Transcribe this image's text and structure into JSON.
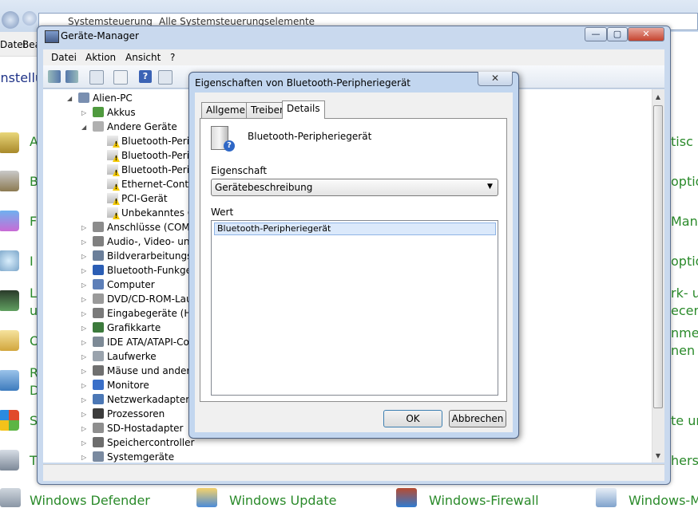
{
  "control_panel": {
    "breadcrumb": [
      "Systemsteuerung",
      "Alle Systemsteuerungselemente"
    ],
    "menu": [
      "Datei",
      "Bea"
    ],
    "heading_fragment": "instellu",
    "left_fragments": [
      "A",
      "B",
      "F",
      "I",
      "L",
      "u",
      "O",
      "R",
      "D",
      "S",
      "T"
    ],
    "right_fragments": [
      "tisc",
      "optio",
      "Mana",
      "optio",
      "rk- u",
      "ecent",
      "nme",
      "nen",
      "te un",
      "herst"
    ],
    "bottom_items": [
      "Windows Defender",
      "Windows Update",
      "Windows-Firewall",
      "Windows-M"
    ]
  },
  "device_manager": {
    "title": "Geräte-Manager",
    "caption_buttons": {
      "minimize": "—",
      "maximize": "▢",
      "close": "✕"
    },
    "menu": [
      "Datei",
      "Aktion",
      "Ansicht",
      "?"
    ],
    "tree": [
      {
        "label": "Alien-PC",
        "level": 0,
        "expanded": true,
        "icon": "computer-icon"
      },
      {
        "label": "Akkus",
        "level": 1,
        "expanded": false,
        "icon": "battery-icon"
      },
      {
        "label": "Andere Geräte",
        "level": 1,
        "expanded": true,
        "icon": "unknown-device-icon"
      },
      {
        "label": "Bluetooth-Peripherieg",
        "level": 2,
        "warning": true
      },
      {
        "label": "Bluetooth-Peripherieg",
        "level": 2,
        "warning": true
      },
      {
        "label": "Bluetooth-Peripherieg",
        "level": 2,
        "warning": true
      },
      {
        "label": "Ethernet-Controller",
        "level": 2,
        "warning": true
      },
      {
        "label": "PCI-Gerät",
        "level": 2,
        "warning": true
      },
      {
        "label": "Unbekanntes Gerät",
        "level": 2,
        "warning": true
      },
      {
        "label": "Anschlüsse (COM & LPT)",
        "level": 1,
        "icon": "port-icon"
      },
      {
        "label": "Audio-, Video- und Gamecontroller",
        "level": 1,
        "icon": "speaker-icon"
      },
      {
        "label": "Bildverarbeitungsgeräte",
        "level": 1,
        "icon": "camera-icon"
      },
      {
        "label": "Bluetooth-Funkgerät",
        "level": 1,
        "icon": "bluetooth-icon"
      },
      {
        "label": "Computer",
        "level": 1,
        "icon": "monitor-icon"
      },
      {
        "label": "DVD/CD-ROM-Laufwerke",
        "level": 1,
        "icon": "dvd-drive-icon"
      },
      {
        "label": "Eingabegeräte (Human Interface Devices)",
        "level": 1,
        "icon": "hid-icon"
      },
      {
        "label": "Grafikkarte",
        "level": 1,
        "icon": "display-adapter-icon"
      },
      {
        "label": "IDE ATA/ATAPI-Controller",
        "level": 1,
        "icon": "ide-icon"
      },
      {
        "label": "Laufwerke",
        "level": 1,
        "icon": "disk-drive-icon"
      },
      {
        "label": "Mäuse und andere Zeigegeräte",
        "level": 1,
        "icon": "mouse-icon"
      },
      {
        "label": "Monitore",
        "level": 1,
        "icon": "monitor-icon"
      },
      {
        "label": "Netzwerkadapter",
        "level": 1,
        "icon": "network-adapter-icon"
      },
      {
        "label": "Prozessoren",
        "level": 1,
        "icon": "processor-icon"
      },
      {
        "label": "SD-Hostadapter",
        "level": 1,
        "icon": "sd-card-icon"
      },
      {
        "label": "Speichercontroller",
        "level": 1,
        "icon": "storage-controller-icon"
      },
      {
        "label": "Systemgeräte",
        "level": 1,
        "icon": "system-devices-icon"
      }
    ]
  },
  "dialog": {
    "title": "Eigenschaften von Bluetooth-Peripheriegerät",
    "close_glyph": "✕",
    "tabs": [
      "Allgemein",
      "Treiber",
      "Details"
    ],
    "active_tab": "Details",
    "device_name": "Bluetooth-Peripheriegerät",
    "property_label": "Eigenschaft",
    "property_value": "Gerätebeschreibung",
    "value_label": "Wert",
    "values": [
      "Bluetooth-Peripheriegerät"
    ],
    "ok_label": "OK",
    "cancel_label": "Abbrechen"
  }
}
